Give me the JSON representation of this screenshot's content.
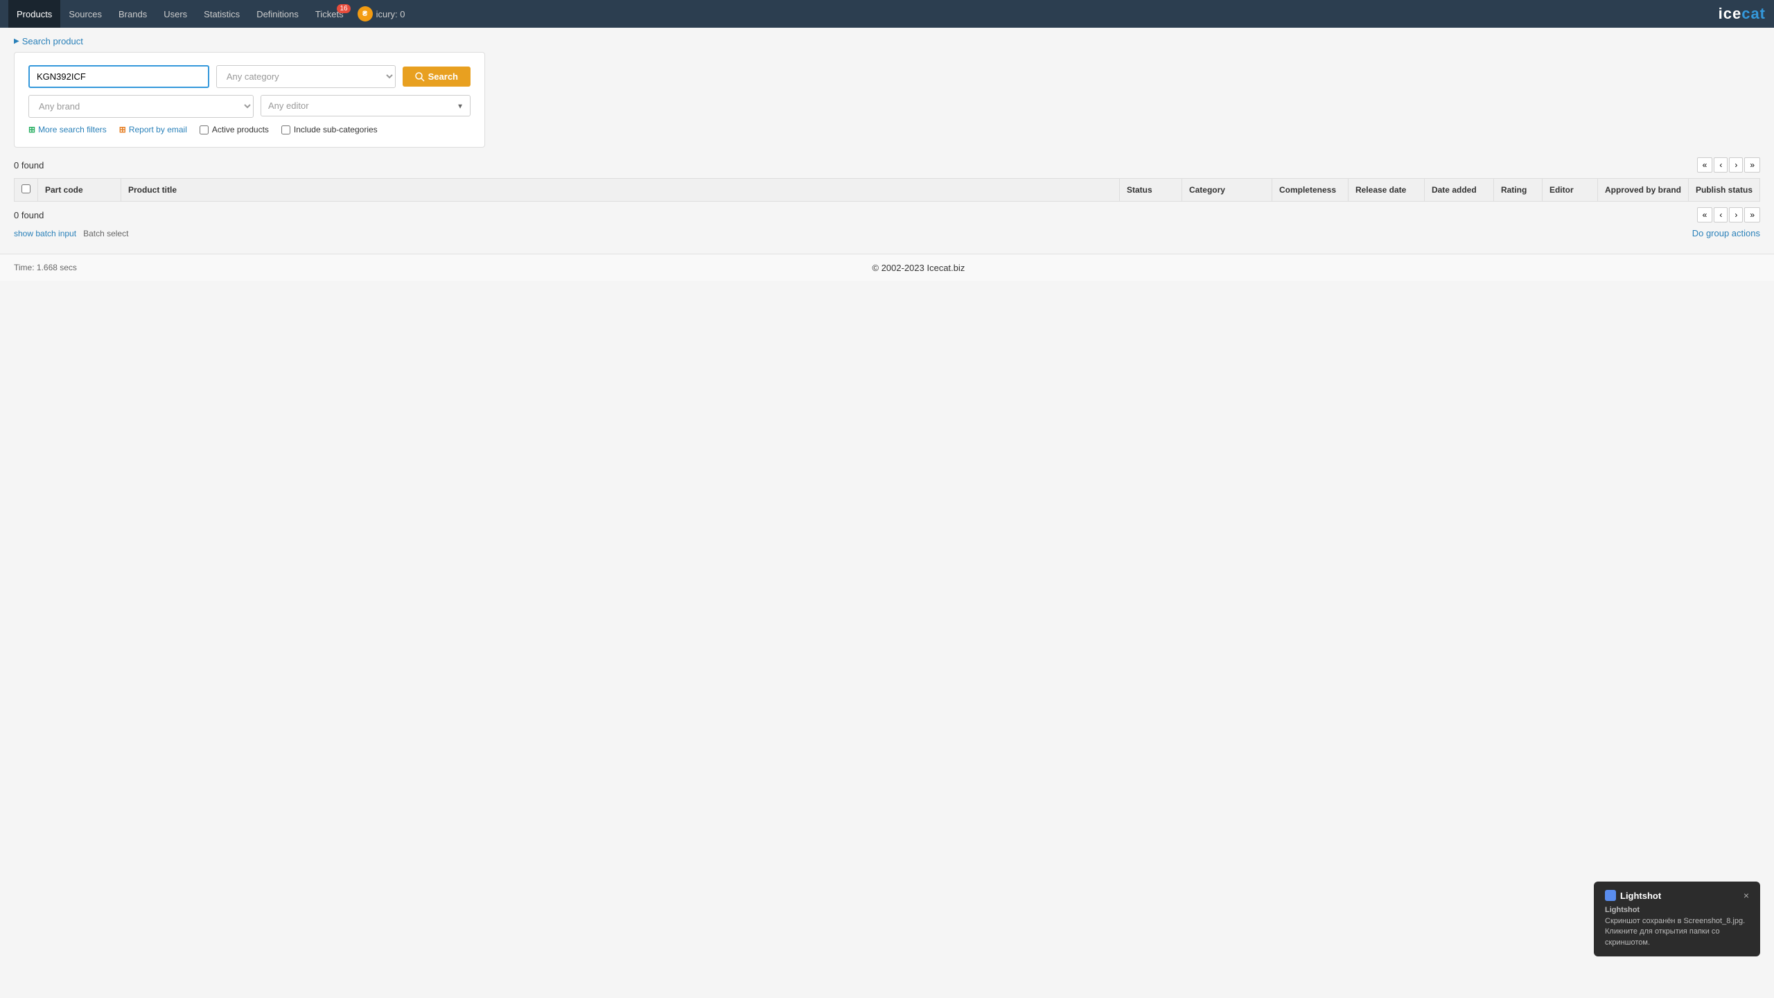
{
  "nav": {
    "links": [
      {
        "label": "Products",
        "href": "#",
        "active": true
      },
      {
        "label": "Sources",
        "href": "#",
        "active": false
      },
      {
        "label": "Brands",
        "href": "#",
        "active": false
      },
      {
        "label": "Users",
        "href": "#",
        "active": false
      },
      {
        "label": "Statistics",
        "href": "#",
        "active": false
      },
      {
        "label": "Definitions",
        "href": "#",
        "active": false
      },
      {
        "label": "Tickets",
        "href": "#",
        "active": false,
        "badge": "16"
      }
    ],
    "currency": {
      "icon": "₴",
      "label": "icury: 0"
    },
    "logo": "icecat"
  },
  "search_product_toggle": "Search product",
  "search": {
    "part_code_placeholder": "KGN392ICF",
    "part_code_value": "KGN392ICF",
    "category_placeholder": "Any category",
    "brand_placeholder": "Any brand",
    "editor_placeholder": "Any editor",
    "search_button_label": "Search",
    "more_filters_label": "More search filters",
    "report_by_email_label": "Report by email",
    "active_products_label": "Active products",
    "include_subcategories_label": "Include sub-categories"
  },
  "results": {
    "found_top": "0 found",
    "found_bottom": "0 found",
    "pagination": {
      "first": "«",
      "prev": "‹",
      "next": "›",
      "last": "»"
    }
  },
  "table": {
    "columns": [
      "Part code",
      "Product title",
      "Status",
      "Category",
      "Completeness",
      "Release date",
      "Date added",
      "Rating",
      "Editor",
      "Approved by brand",
      "Publish status"
    ]
  },
  "batch": {
    "show_batch_input": "show batch input",
    "batch_select": "Batch select"
  },
  "group_actions": "Do group actions",
  "footer": {
    "copyright": "© 2002-2023 Icecat.biz",
    "time": "Time: 1.668 secs"
  },
  "lightshot": {
    "title": "Lightshot",
    "body": "Скриншот сохранён в Screenshot_8.jpg.\nКликните для открытия папки со скриншотом.",
    "close": "×"
  }
}
